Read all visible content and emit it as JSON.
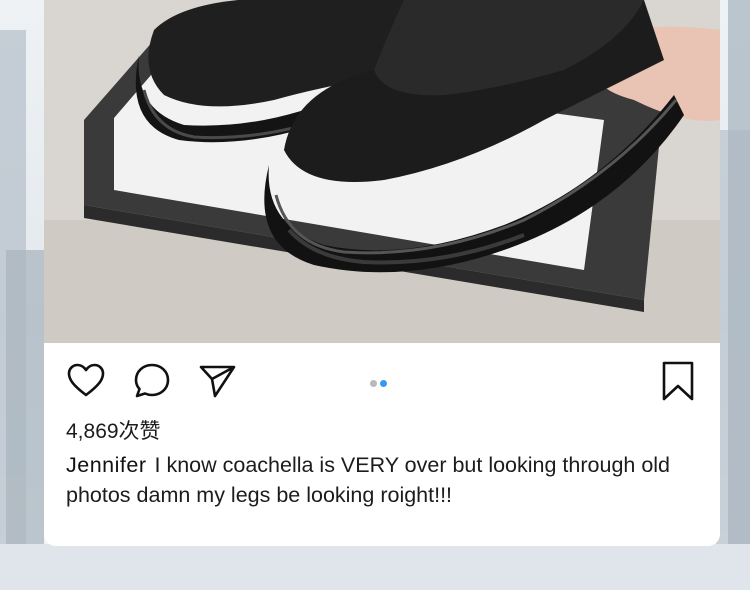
{
  "post": {
    "likes": "4,869次赞",
    "username": "Jennifer",
    "caption": "I know coachella is VERY over but looking through old photos damn my legs be looking roight!!!"
  },
  "icons": {
    "like": "heart-outline-icon",
    "comment": "comment-bubble-icon",
    "share": "paper-plane-icon",
    "save": "bookmark-outline-icon"
  },
  "carousel": {
    "total": 2,
    "active": 2
  },
  "colors": {
    "dot_active": "#3897f0",
    "dot_inactive": "#b9b9b9",
    "text": "#1c1c1c"
  }
}
